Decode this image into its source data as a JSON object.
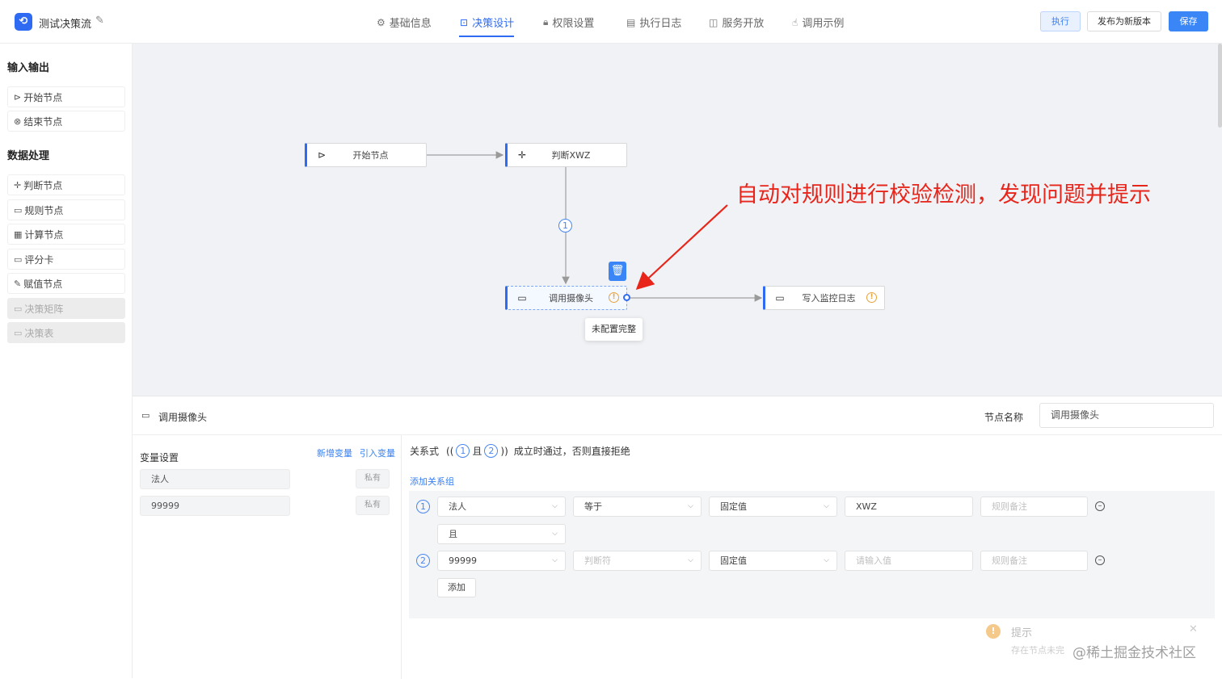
{
  "app": {
    "title": "测试决策流"
  },
  "tabs": [
    {
      "label": "基础信息",
      "icon": "gear-icon",
      "active": false
    },
    {
      "label": "决策设计",
      "icon": "flow-icon",
      "active": true
    },
    {
      "label": "权限设置",
      "icon": "lock-icon",
      "active": false
    },
    {
      "label": "执行日志",
      "icon": "document-icon",
      "active": false
    },
    {
      "label": "服务开放",
      "icon": "book-icon",
      "active": false
    },
    {
      "label": "调用示例",
      "icon": "hand-icon",
      "active": false
    }
  ],
  "actions": {
    "run": "执行",
    "publish": "发布为新版本",
    "save": "保存"
  },
  "sidebar": {
    "sections": [
      {
        "title": "输入输出",
        "items": [
          {
            "label": "开始节点",
            "icon": "play-icon",
            "disabled": false
          },
          {
            "label": "结束节点",
            "icon": "stop-icon",
            "disabled": false
          }
        ]
      },
      {
        "title": "数据处理",
        "items": [
          {
            "label": "判断节点",
            "icon": "move-icon",
            "disabled": false
          },
          {
            "label": "规则节点",
            "icon": "card-icon",
            "disabled": false
          },
          {
            "label": "计算节点",
            "icon": "calculator-icon",
            "disabled": false
          },
          {
            "label": "评分卡",
            "icon": "card-icon",
            "disabled": false
          },
          {
            "label": "赋值节点",
            "icon": "edit-icon",
            "disabled": false
          },
          {
            "label": "决策矩阵",
            "icon": "card-icon",
            "disabled": true
          },
          {
            "label": "决策表",
            "icon": "card-icon",
            "disabled": true
          }
        ]
      }
    ]
  },
  "canvas": {
    "nodes": {
      "start": {
        "label": "开始节点",
        "icon": "play-icon"
      },
      "judge": {
        "label": "判断XWZ",
        "icon": "move-icon"
      },
      "camera": {
        "label": "调用摄像头",
        "icon": "card-icon",
        "warning": "!"
      },
      "log": {
        "label": "写入监控日志",
        "icon": "card-icon",
        "warning": "!"
      }
    },
    "branch_label": "1",
    "tooltip": "未配置完整",
    "annotation": "自动对规则进行校验检测，发现问题并提示",
    "colors": {
      "accent": "#2f6bf2",
      "warning": "#e8a33d",
      "annotation": "#e8251b",
      "canvas_bg": "#f0f2f5"
    }
  },
  "panel": {
    "node_title": "调用摄像头",
    "node_name_label": "节点名称",
    "node_name_value": "调用摄像头",
    "variables": {
      "title": "变量设置",
      "add_link": "新增变量",
      "import_link": "引入变量",
      "items": [
        {
          "name": "法人",
          "scope": "私有"
        },
        {
          "name": "99999",
          "scope": "私有"
        }
      ]
    },
    "relation": {
      "prefix": "关系式",
      "open": "((",
      "n1": "1",
      "conj": "且",
      "n2": "2",
      "close": "))",
      "suffix": "成立时通过，否则直接拒绝",
      "add_group": "添加关系组"
    },
    "conditions": [
      {
        "index": "1",
        "field": "法人",
        "operator": "等于",
        "operator_placeholder": false,
        "value_type": "固定值",
        "value": "XWZ",
        "value_placeholder": false,
        "remark": "规则备注"
      },
      {
        "index": "2",
        "field": "99999",
        "operator": "判断符",
        "operator_placeholder": true,
        "value_type": "固定值",
        "value": "请输入值",
        "value_placeholder": true,
        "remark": "规则备注"
      }
    ],
    "joiner": "且",
    "add_button": "添加"
  },
  "toast": {
    "title": "提示",
    "message": "存在节点未完"
  },
  "watermark": "@稀土掘金技术社区"
}
